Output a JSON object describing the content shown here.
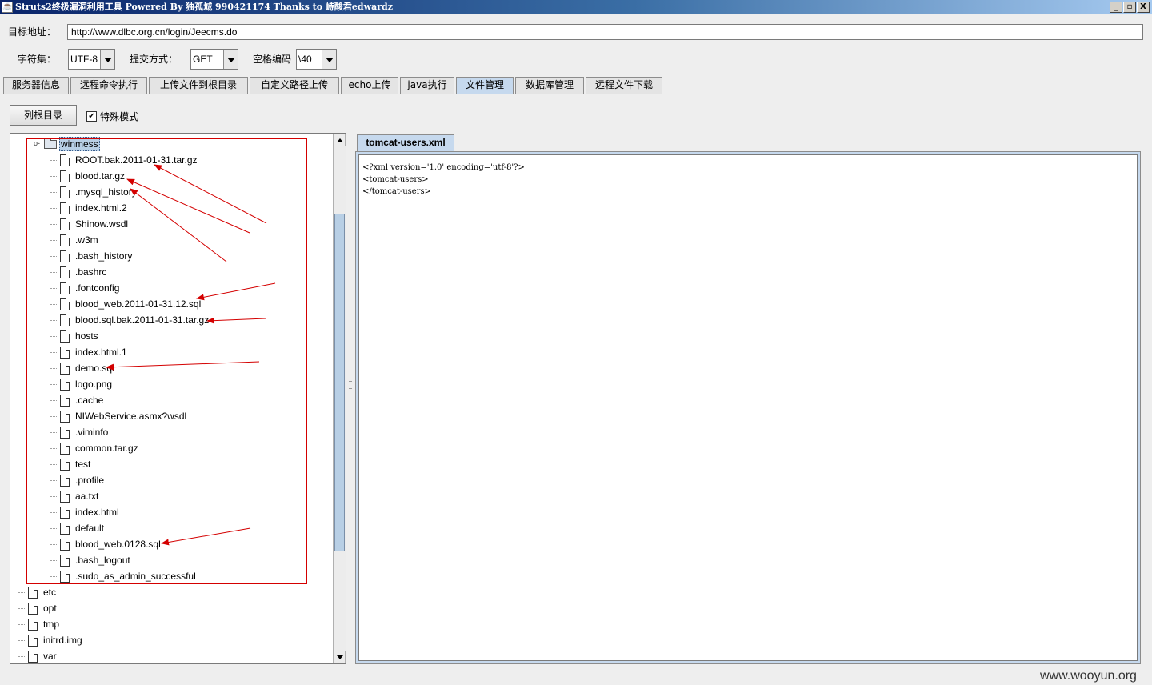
{
  "window": {
    "title": "Struts2终极漏洞利用工具  Powered By 独孤城 990421174 Thanks to 峙酸君edwardz",
    "controls": [
      "_",
      "▫",
      "X"
    ]
  },
  "target": {
    "label": "目标地址：",
    "url": "http://www.dlbc.org.cn/login/Jeecms.do"
  },
  "options": {
    "charset_label": "字符集：",
    "charset_value": "UTF-8",
    "method_label": "提交方式：",
    "method_value": "GET",
    "space_label": "空格编码",
    "space_value": "\\40"
  },
  "tabs": [
    {
      "label": "服务器信息"
    },
    {
      "label": "远程命令执行"
    },
    {
      "label": "上传文件到根目录"
    },
    {
      "label": "自定义路径上传"
    },
    {
      "label": "echo上传"
    },
    {
      "label": "java执行"
    },
    {
      "label": "文件管理",
      "active": true
    },
    {
      "label": "数据库管理"
    },
    {
      "label": "远程文件下载"
    }
  ],
  "file_manager": {
    "list_root_button": "列根目录",
    "special_mode_label": "特殊模式",
    "special_mode_checked": true,
    "tree": {
      "folder": "winmess",
      "expander": "o-",
      "children": [
        "ROOT.bak.2011-01-31.tar.gz",
        "blood.tar.gz",
        ".mysql_history",
        "index.html.2",
        "Shinow.wsdl",
        ".w3m",
        ".bash_history",
        ".bashrc",
        ".fontconfig",
        "blood_web.2011-01-31.12.sql",
        "blood.sql.bak.2011-01-31.tar.gz",
        "hosts",
        "index.html.1",
        "demo.sql",
        "logo.png",
        ".cache",
        "NIWebService.asmx?wsdl",
        ".viminfo",
        "common.tar.gz",
        "test",
        ".profile",
        "aa.txt",
        "index.html",
        "default",
        "blood_web.0128.sql",
        ".bash_logout",
        ".sudo_as_admin_successful"
      ],
      "root_items": [
        "etc",
        "opt",
        "tmp",
        "initrd.img",
        "var"
      ]
    },
    "editor": {
      "tab": "tomcat-users.xml",
      "content": "<?xml version='1.0' encoding='utf-8'?>\n<tomcat-users>\n</tomcat-users>"
    },
    "annotation_color": "#d40000"
  },
  "watermark": "www.wooyun.org",
  "colors": {
    "active_tab": "#c6d9ee",
    "annotation": "#d40000",
    "titlebar": "#0a246a"
  }
}
